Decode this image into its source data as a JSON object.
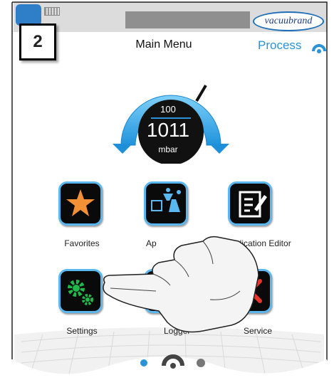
{
  "step": {
    "number": "2"
  },
  "brand": {
    "name": "vacuubrand"
  },
  "header": {
    "title": "Main Menu",
    "process_label": "Process"
  },
  "gauge": {
    "setpoint": "100",
    "value": "1011",
    "unit": "mbar"
  },
  "tiles": [
    {
      "label": "Favorites"
    },
    {
      "label": "Ap"
    },
    {
      "label": "Application Editor"
    },
    {
      "label": "Settings"
    },
    {
      "label": "Logger"
    },
    {
      "label": "Service"
    }
  ],
  "colors": {
    "accent": "#2a93d8",
    "tile_border": "#5ab7ef",
    "star": "#f29035",
    "gear": "#1fb84a",
    "service": "#e8352c"
  },
  "pager": {
    "pages": 3,
    "current": 1
  }
}
